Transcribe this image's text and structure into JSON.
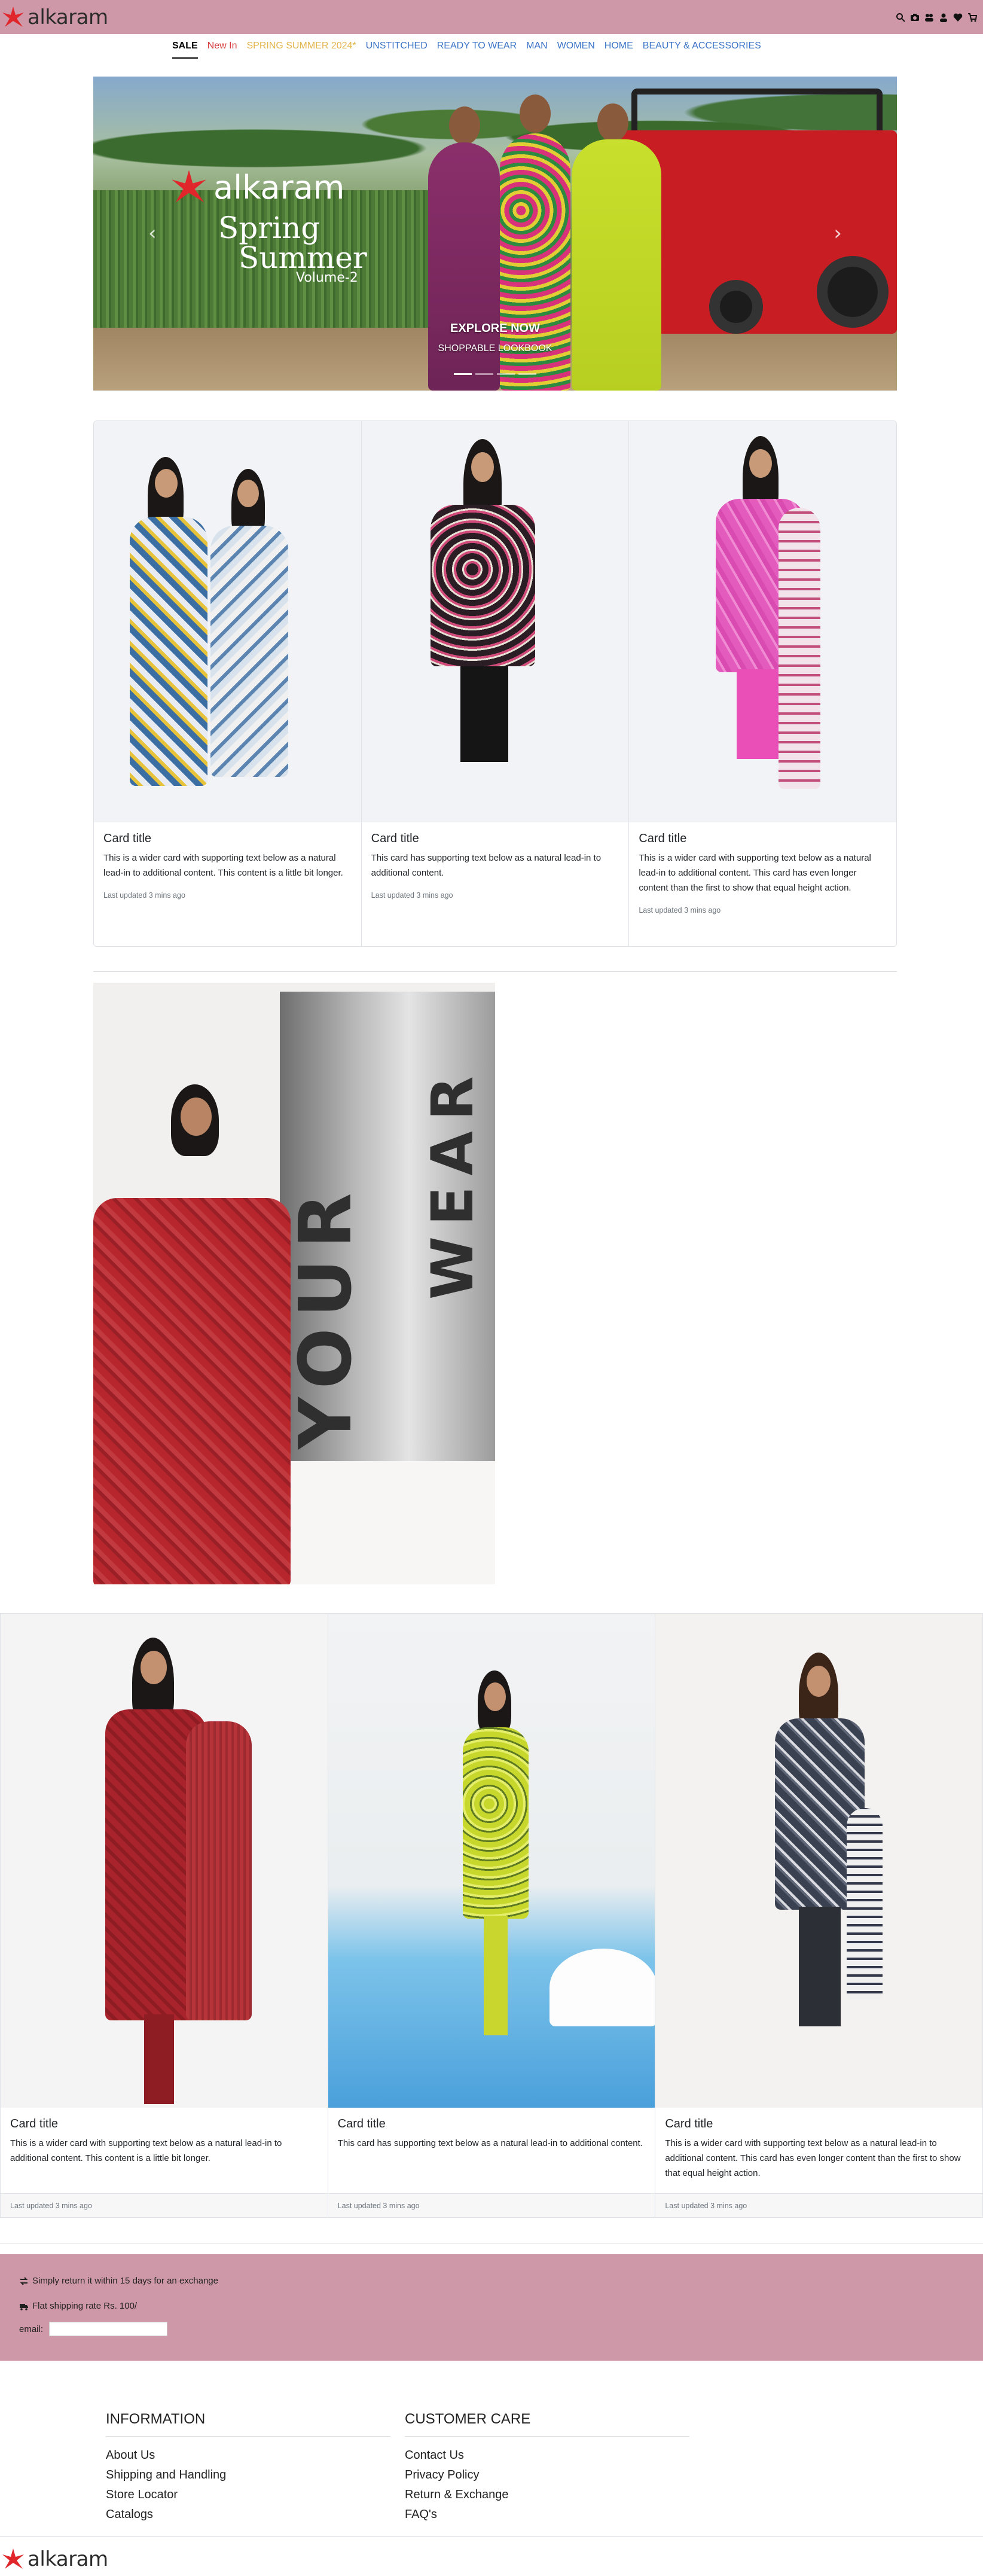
{
  "brand": {
    "name": "alkaram",
    "accent": "#cf98a8",
    "logo_red": "#e0262b"
  },
  "header": {
    "icons": [
      "search-icon",
      "camera-icon",
      "users-icon",
      "user-icon",
      "heart-icon",
      "cart-icon"
    ]
  },
  "nav": {
    "items": [
      {
        "label": "SALE",
        "color": "#000000"
      },
      {
        "label": "New In",
        "color": "#d63a3a"
      },
      {
        "label": "SPRING SUMMER 2024*",
        "color": "#e2b54b"
      },
      {
        "label": "UNSTITCHED",
        "color": "#3b74c7"
      },
      {
        "label": "READY TO WEAR",
        "color": "#3b74c7"
      },
      {
        "label": "MAN",
        "color": "#3b74c7"
      },
      {
        "label": "WOMEN",
        "color": "#3b74c7"
      },
      {
        "label": "HOME",
        "color": "#3b74c7"
      },
      {
        "label": "BEAUTY & ACCESSORIES",
        "color": "#3b74c7"
      }
    ]
  },
  "hero": {
    "brand": "alkaram",
    "line1": "Spring",
    "line2": "Summer",
    "volume": "Volume-2",
    "cta": "EXPLORE NOW",
    "sub": "SHOPPABLE LOOKBOOK",
    "prev_icon": "chevron-left-icon",
    "next_icon": "chevron-right-icon",
    "slides": 4,
    "active_slide": 1
  },
  "group1": {
    "cards": [
      {
        "title": "Card title",
        "text": "This is a wider card with supporting text below as a natural lead-in to additional content. This content is a little bit longer.",
        "updated": "Last updated 3 mins ago"
      },
      {
        "title": "Card title",
        "text": "This card has supporting text below as a natural lead-in to additional content.",
        "updated": "Last updated 3 mins ago"
      },
      {
        "title": "Card title",
        "text": "This is a wider card with supporting text below as a natural lead-in to additional content. This card has even longer content than the first to show that equal height action.",
        "updated": "Last updated 3 mins ago"
      }
    ]
  },
  "banner": {
    "word1": "WEAR",
    "word2": "YOUR"
  },
  "group2": {
    "cards": [
      {
        "title": "Card title",
        "text": "This is a wider card with supporting text below as a natural lead-in to additional content. This content is a little bit longer.",
        "updated": "Last updated 3 mins ago"
      },
      {
        "title": "Card title",
        "text": "This card has supporting text below as a natural lead-in to additional content.",
        "updated": "Last updated 3 mins ago"
      },
      {
        "title": "Card title",
        "text": "This is a wider card with supporting text below as a natural lead-in to additional content. This card has even longer content than the first to show that equal height action.",
        "updated": "Last updated 3 mins ago"
      }
    ]
  },
  "band": {
    "exchange": "Simply return it within 15 days for an exchange",
    "shipping": "Flat shipping rate Rs. 100/",
    "email_label": "email:",
    "email_value": ""
  },
  "footer": {
    "information": {
      "heading": "INFORMATION",
      "links": [
        "About Us",
        "Shipping and Handling",
        "Store Locator",
        "Catalogs"
      ]
    },
    "care": {
      "heading": "CUSTOMER CARE",
      "links": [
        "Contact Us",
        "Privacy Policy",
        "Return & Exchange",
        "FAQ's"
      ]
    }
  }
}
